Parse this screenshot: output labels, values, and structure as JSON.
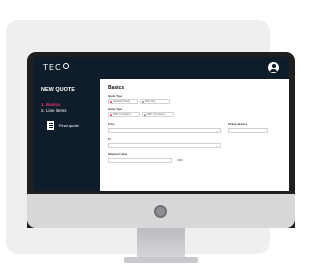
{
  "app": {
    "logo_text": "TEC"
  },
  "sidebar": {
    "title": "NEW QUOTE",
    "steps": [
      {
        "label": "1. Basics",
        "active": true
      },
      {
        "label": "2. Line items",
        "active": false
      }
    ],
    "final_quote_label": "Final quote"
  },
  "form": {
    "section_title": "Basics",
    "quote_type_label": "Quote Type",
    "quote_type_options": [
      {
        "label": "Standard (DAA)",
        "selected": true
      },
      {
        "label": "Shift Only",
        "selected": false
      }
    ],
    "quote_type2_label": "Quote Type",
    "quote_type2_options": [
      {
        "label": "DDP Compliance",
        "selected": true
      },
      {
        "label": "DDU Compliance",
        "selected": false
      }
    ],
    "from_label": "From",
    "pickup_address_label": "Pickup address",
    "to_label": "To",
    "shipment_value_label": "Shipment value",
    "currency_unit": "USD"
  },
  "colors": {
    "accent": "#e8336f",
    "nav_bg": "#0f1d2b"
  },
  "icons": {
    "avatar": "user-circle-icon",
    "final_quote": "document-icon",
    "dropdown": "chevron-down-icon"
  }
}
